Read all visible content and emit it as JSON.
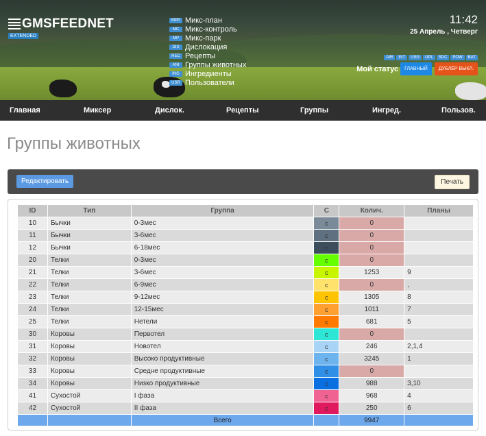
{
  "header": {
    "logo_text": "GMSFEEDNET",
    "logo_badge": "EXTENDED",
    "clock": "11:42",
    "date": "25 Апрель , Четверг",
    "menu": [
      {
        "code": "MPP",
        "label": "Микс-план"
      },
      {
        "code": "MC",
        "label": "Микс-контроль"
      },
      {
        "code": "MP",
        "label": "Микс-парк"
      },
      {
        "code": "DIS",
        "label": "Дислокация"
      },
      {
        "code": "REC",
        "label": "Рецепты"
      },
      {
        "code": "ANI",
        "label": "Группы животных"
      },
      {
        "code": "ING",
        "label": "Ингредиенты"
      },
      {
        "code": "USR",
        "label": "Пользователи"
      }
    ],
    "status_badges": [
      "AIR",
      "INT",
      "USG",
      "UPL",
      "SDC",
      "POW",
      "BAT"
    ],
    "status_label": "Мой статус",
    "btn_main": "ГЛАВНЫЙ",
    "btn_dup": "ДУБЛЁР ВЫКЛ."
  },
  "nav": [
    "Главная",
    "Миксер",
    "Дислок.",
    "Рецепты",
    "Группы",
    "Ингред.",
    "Пользов."
  ],
  "page_title": "Группы животных",
  "toolbar": {
    "edit_label": "Редактировать",
    "print_label": "Печать"
  },
  "table": {
    "headers": [
      "ID",
      "Тип",
      "Группа",
      "C",
      "Колич.",
      "Планы"
    ],
    "rows": [
      {
        "id": "10",
        "type": "Бычки",
        "group": "0-3мес",
        "c": "c",
        "color": "#7a8a98",
        "qty": "0",
        "plans": ""
      },
      {
        "id": "11",
        "type": "Бычки",
        "group": "3-6мес",
        "c": "c",
        "color": "#5f7080",
        "qty": "0",
        "plans": ""
      },
      {
        "id": "12",
        "type": "Бычки",
        "group": "6-18мес",
        "c": "c",
        "color": "#3c4d5c",
        "qty": "0",
        "plans": ""
      },
      {
        "id": "20",
        "type": "Телки",
        "group": "0-3мес",
        "c": "c",
        "color": "#66ff00",
        "qty": "0",
        "plans": ""
      },
      {
        "id": "21",
        "type": "Телки",
        "group": "3-6мес",
        "c": "c",
        "color": "#c8f500",
        "qty": "1253",
        "plans": "9"
      },
      {
        "id": "22",
        "type": "Телки",
        "group": "6-9мес",
        "c": "c",
        "color": "#ffe26b",
        "qty": "0",
        "plans": ","
      },
      {
        "id": "23",
        "type": "Телки",
        "group": "9-12мес",
        "c": "c",
        "color": "#ffc400",
        "qty": "1305",
        "plans": "8"
      },
      {
        "id": "24",
        "type": "Телки",
        "group": "12-15мес",
        "c": "c",
        "color": "#ffa030",
        "qty": "1011",
        "plans": "7"
      },
      {
        "id": "25",
        "type": "Телки",
        "group": "Нетели",
        "c": "c",
        "color": "#ff7a00",
        "qty": "681",
        "plans": "5"
      },
      {
        "id": "30",
        "type": "Коровы",
        "group": "Первотел",
        "c": "c",
        "color": "#2ee6d6",
        "qty": "0",
        "plans": ""
      },
      {
        "id": "31",
        "type": "Коровы",
        "group": "Новотел",
        "c": "c",
        "color": "#a9d4f5",
        "qty": "246",
        "plans": "2,1,4"
      },
      {
        "id": "32",
        "type": "Коровы",
        "group": "Высоко продуктивные",
        "c": "c",
        "color": "#6db3ee",
        "qty": "3245",
        "plans": "1"
      },
      {
        "id": "33",
        "type": "Коровы",
        "group": "Средне продуктивные",
        "c": "c",
        "color": "#2f8fe6",
        "qty": "0",
        "plans": ""
      },
      {
        "id": "34",
        "type": "Коровы",
        "group": "Низко продуктивные",
        "c": "c",
        "color": "#0a6fe0",
        "qty": "988",
        "plans": "3,10"
      },
      {
        "id": "41",
        "type": "Сухостой",
        "group": "I фаза",
        "c": "c",
        "color": "#f06292",
        "qty": "968",
        "plans": "4"
      },
      {
        "id": "42",
        "type": "Сухостой",
        "group": "II фаза",
        "c": "c",
        "color": "#e0195e",
        "qty": "250",
        "plans": "6"
      }
    ],
    "total_label": "Всего",
    "total_qty": "9947"
  }
}
